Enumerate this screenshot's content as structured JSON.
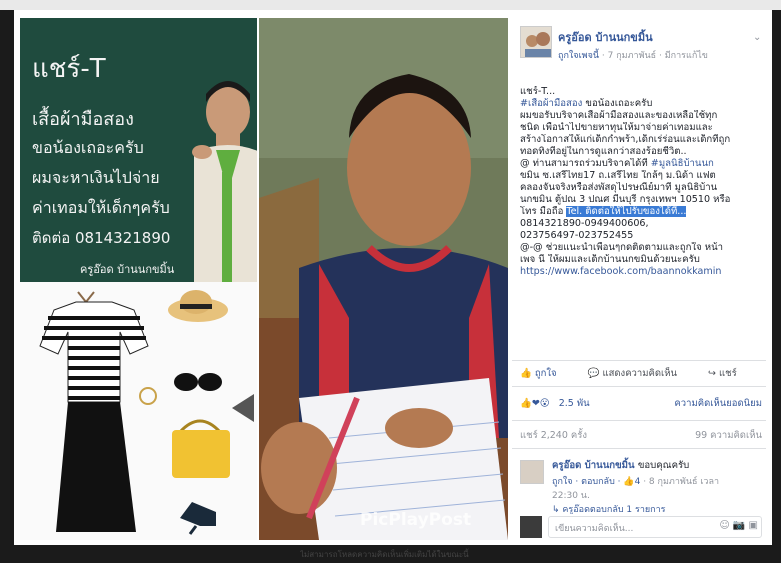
{
  "poster": {
    "lines": [
      "แชร์-T",
      "เสื้อผ้ามือสอง",
      "ขอน้องเถอะครับ",
      "ผมจะหาเงินไปจ่าย",
      "ค่าเทอมให้เด็กๆครับ",
      "ติดต่อ 0814321890",
      "ครูอ๊อด บ้านนกขมิ้น"
    ]
  },
  "watermark": "PicPlayPost",
  "post": {
    "author": "ครูอ๊อด บ้านนกขมิ้น",
    "meta_link": "ถูกใจเพจนี้",
    "meta_date": "· 7 กุมภาพันธ์ ·",
    "meta_audience": "มีการแก้ไข",
    "body_lines": [
      [
        "แชร์-T...",
        ""
      ],
      [
        "#เสื้อผ้ามือสอง",
        " ขอน้องเถอะครับ"
      ],
      [
        "ผมขอรับบริจาคเสื้อผ้ามือสองและของเหลือใช้ทุก",
        ""
      ],
      [
        "ชนิด เพื่อนำไปขายหาทุนให้มาจ่ายค่าเทอมและ",
        ""
      ],
      [
        "สร้างโอกาสให้แก่เด็กกำพร้า,เด็กเร่ร่อนและเด็กที่ถูก",
        ""
      ],
      [
        "ทอดทิ้งที่อยู่ในการดูแลกว่าสองร้อยชีวิต..",
        ""
      ],
      [
        "@ ท่านสามารถร่วมบริจาคได้ที่ ",
        "#มูลนิธิบ้านนก"
      ],
      [
        "ขมิ้น",
        " ซ.เสรีไทย17 ถ.เสรีไทย ใกล้ๆ ม.นิด้า แฟต"
      ],
      [
        "คลองจั่นจริงหรือส่งพัสดุไปรษณีย์มาที่ มูลนิธิบ้าน",
        ""
      ],
      [
        "นกขมิ้น ตู้ปณ 3 ปณศ มีนบุรี กรุงเทพฯ 10510 หรือ",
        ""
      ],
      [
        "โทร มือถือ ",
        "Tel. ติดต่อให้ไปรับของได้ที่...",
        "sel"
      ],
      [
        "0814321890-0949400606,",
        ""
      ],
      [
        "023756497-023752455",
        ""
      ],
      [
        "@-@ ช่วยแนะนำเพื่อนๆกดติดตามและถูกใจ หน้า",
        ""
      ],
      [
        "เพจ นี้ ให้ผมและเด็กบ้านนกขมิ้นด้วยนะครับ",
        ""
      ],
      [
        "https://www.facebook.com/baannokkamin",
        "",
        "link"
      ]
    ]
  },
  "actions": {
    "like": "ถูกใจ",
    "comment": "แสดงความคิดเห็น",
    "share": "แชร์"
  },
  "reactions": {
    "icons": "👍❤😮",
    "count": "2.5 พัน",
    "view_more": "ความคิดเห็นยอดนิยม"
  },
  "shares": {
    "count": "แชร์ 2,240 ครั้ง",
    "comments": "99 ความคิดเห็น"
  },
  "comment": {
    "author": "ครูอ๊อด บ้านนกขมิ้น",
    "text": "ขอบคุณครับ",
    "meta_like": "ถูกใจ · ตอบกลับ ·",
    "meta_likes": "👍4",
    "meta_date": "· 8 กุมภาพันธ์ เวลา",
    "time": "22:30 น.",
    "reply_link": "↳ ครูอ๊อดตอบกลับ 1 รายการ"
  },
  "compose": {
    "placeholder": "เขียนความคิดเห็น...",
    "icons": "☺ 📷 ▣"
  },
  "footer_text": "ไม่สามารถโหลดความคิดเห็นเพิ่มเติมได้ในขณะนี้"
}
